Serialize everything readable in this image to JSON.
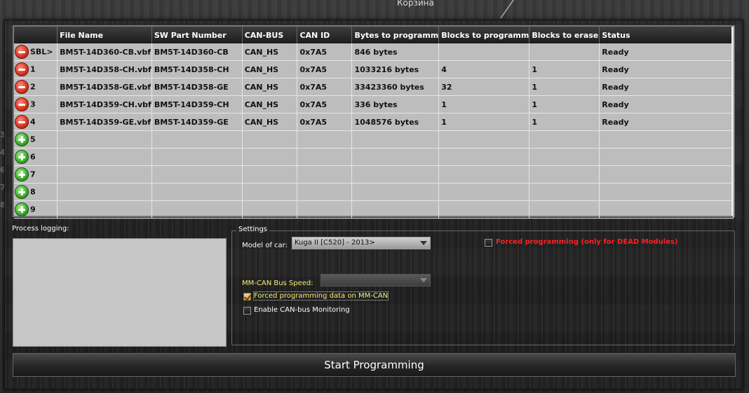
{
  "desktop": {
    "top_label": "Корзина"
  },
  "table": {
    "columns": [
      "",
      "File Name",
      "SW Part Number",
      "CAN-BUS",
      "CAN ID",
      "Bytes to programm",
      "Blocks to programm",
      "Blocks to erase",
      "Status"
    ],
    "rows": [
      {
        "label": "SBL>",
        "icon": "minus",
        "file": "BM5T-14D360-CB.vbf",
        "sw": "BM5T-14D360-CB",
        "bus": "CAN_HS",
        "id": "0x7A5",
        "bytes": "846 bytes",
        "blocks": "",
        "erase": "",
        "status": "Ready"
      },
      {
        "label": "1",
        "icon": "minus",
        "file": "BM5T-14D358-CH.vbf",
        "sw": "BM5T-14D358-CH",
        "bus": "CAN_HS",
        "id": "0x7A5",
        "bytes": "1033216 bytes",
        "blocks": "4",
        "erase": "1",
        "status": "Ready"
      },
      {
        "label": "2",
        "icon": "minus",
        "file": "BM5T-14D358-GE.vbf",
        "sw": "BM5T-14D358-GE",
        "bus": "CAN_HS",
        "id": "0x7A5",
        "bytes": "33423360 bytes",
        "blocks": "32",
        "erase": "1",
        "status": "Ready"
      },
      {
        "label": "3",
        "icon": "minus",
        "file": "BM5T-14D359-CH.vbf",
        "sw": "BM5T-14D359-CH",
        "bus": "CAN_HS",
        "id": "0x7A5",
        "bytes": "336 bytes",
        "blocks": "1",
        "erase": "1",
        "status": "Ready"
      },
      {
        "label": "4",
        "icon": "minus",
        "file": "BM5T-14D359-GE.vbf",
        "sw": "BM5T-14D359-GE",
        "bus": "CAN_HS",
        "id": "0x7A5",
        "bytes": "1048576 bytes",
        "blocks": "1",
        "erase": "1",
        "status": "Ready"
      },
      {
        "label": "5",
        "icon": "plus",
        "file": "",
        "sw": "",
        "bus": "",
        "id": "",
        "bytes": "",
        "blocks": "",
        "erase": "",
        "status": ""
      },
      {
        "label": "6",
        "icon": "plus",
        "file": "",
        "sw": "",
        "bus": "",
        "id": "",
        "bytes": "",
        "blocks": "",
        "erase": "",
        "status": ""
      },
      {
        "label": "7",
        "icon": "plus",
        "file": "",
        "sw": "",
        "bus": "",
        "id": "",
        "bytes": "",
        "blocks": "",
        "erase": "",
        "status": ""
      },
      {
        "label": "8",
        "icon": "plus",
        "file": "",
        "sw": "",
        "bus": "",
        "id": "",
        "bytes": "",
        "blocks": "",
        "erase": "",
        "status": ""
      },
      {
        "label": "9",
        "icon": "plus",
        "file": "",
        "sw": "",
        "bus": "",
        "id": "",
        "bytes": "",
        "blocks": "",
        "erase": "",
        "status": ""
      }
    ]
  },
  "logging": {
    "label": "Process logging:",
    "content": ""
  },
  "settings": {
    "legend": "Settings",
    "model_label": "Model of car:",
    "model_value": "Kuga II [C520] - 2013>",
    "forced_label": "Forced programming (only for DEAD Modules)",
    "forced_checked": false,
    "mmcan_speed_label": "MM-CAN Bus Speed:",
    "mmcan_speed_value": "",
    "forced_mmcan_label": "Forced programming data on MM-CAN",
    "forced_mmcan_checked": true,
    "monitor_label": "Enable CAN-bus Monitoring",
    "monitor_checked": false
  },
  "start_button": {
    "label": "Start Programming"
  },
  "colors": {
    "forced_text": "#ff2020",
    "mmcan_text": "#f3f07a",
    "accent": "#c9a765"
  }
}
